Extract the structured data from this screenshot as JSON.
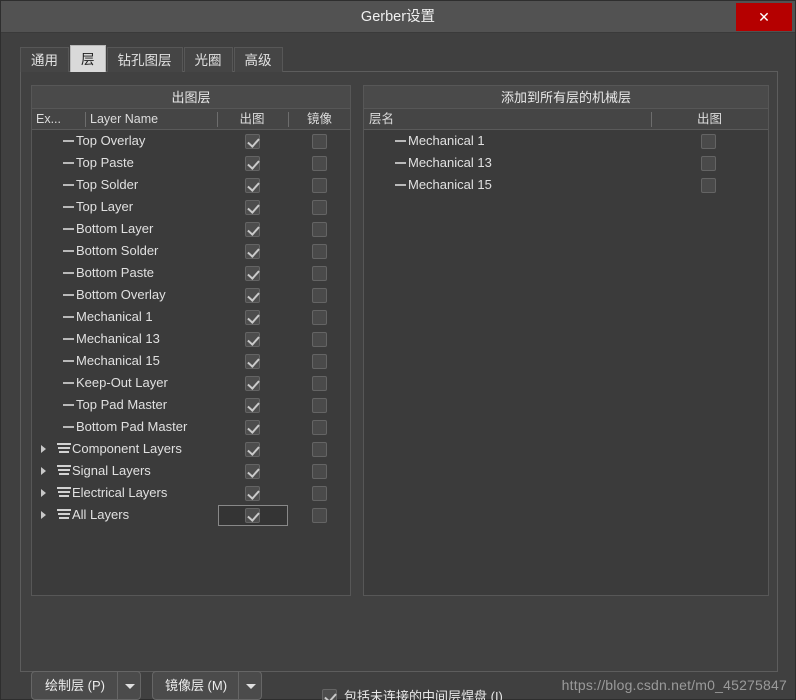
{
  "window": {
    "title": "Gerber设置",
    "close_label": "✕"
  },
  "tabs": [
    {
      "label": "通用",
      "active": false
    },
    {
      "label": "层",
      "active": true
    },
    {
      "label": "钻孔图层",
      "active": false
    },
    {
      "label": "光圈",
      "active": false
    },
    {
      "label": "高级",
      "active": false
    }
  ],
  "left_panel": {
    "title": "出图层",
    "columns": [
      "Ex...",
      "Layer Name",
      "出图",
      "镜像"
    ],
    "rows": [
      {
        "name": "Top Overlay",
        "type": "leaf",
        "plot": true,
        "mirror": false
      },
      {
        "name": "Top Paste",
        "type": "leaf",
        "plot": true,
        "mirror": false
      },
      {
        "name": "Top Solder",
        "type": "leaf",
        "plot": true,
        "mirror": false
      },
      {
        "name": "Top Layer",
        "type": "leaf",
        "plot": true,
        "mirror": false
      },
      {
        "name": "Bottom Layer",
        "type": "leaf",
        "plot": true,
        "mirror": false
      },
      {
        "name": "Bottom Solder",
        "type": "leaf",
        "plot": true,
        "mirror": false
      },
      {
        "name": "Bottom Paste",
        "type": "leaf",
        "plot": true,
        "mirror": false
      },
      {
        "name": "Bottom Overlay",
        "type": "leaf",
        "plot": true,
        "mirror": false
      },
      {
        "name": "Mechanical 1",
        "type": "leaf",
        "plot": true,
        "mirror": false
      },
      {
        "name": "Mechanical 13",
        "type": "leaf",
        "plot": true,
        "mirror": false
      },
      {
        "name": "Mechanical 15",
        "type": "leaf",
        "plot": true,
        "mirror": false
      },
      {
        "name": "Keep-Out Layer",
        "type": "leaf",
        "plot": true,
        "mirror": false
      },
      {
        "name": "Top Pad Master",
        "type": "leaf",
        "plot": true,
        "mirror": false
      },
      {
        "name": "Bottom Pad Master",
        "type": "leaf",
        "plot": true,
        "mirror": false
      },
      {
        "name": "Component Layers",
        "type": "group",
        "plot": true,
        "mirror": false
      },
      {
        "name": "Signal Layers",
        "type": "group",
        "plot": true,
        "mirror": false
      },
      {
        "name": "Electrical Layers",
        "type": "group",
        "plot": true,
        "mirror": false
      },
      {
        "name": "All Layers",
        "type": "group",
        "plot": true,
        "mirror": false,
        "focused": true
      }
    ]
  },
  "right_panel": {
    "title": "添加到所有层的机械层",
    "columns": [
      "层名",
      "出图"
    ],
    "rows": [
      {
        "name": "Mechanical 1",
        "plot": false
      },
      {
        "name": "Mechanical 13",
        "plot": false
      },
      {
        "name": "Mechanical 15",
        "plot": false
      }
    ]
  },
  "footer": {
    "plot_layers_button": "绘制层 (P)",
    "mirror_layers_button": "镜像层 (M)",
    "include_pads_label": "包括未连接的中间层焊盘 (I)",
    "include_pads_checked": true
  },
  "watermark": "https://blog.csdn.net/m0_45275847"
}
